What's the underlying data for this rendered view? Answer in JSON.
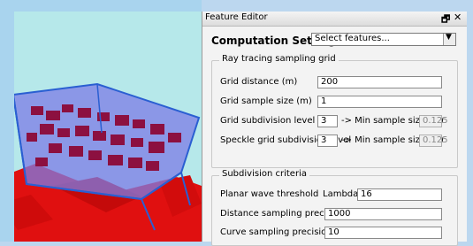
{
  "viewport": {
    "label": "3d-viewport"
  },
  "panel": {
    "title": "Feature Editor",
    "pin_icon": "pin-icon",
    "close_icon": "close-icon"
  },
  "header": {
    "title": "Computation Settings",
    "select_placeholder": "Select features..."
  },
  "ray_tracing": {
    "group_title": "Ray tracing sampling grid",
    "grid_distance_label": "Grid distance (m)",
    "grid_distance_value": "200",
    "grid_sample_size_label": "Grid sample size (m)",
    "grid_sample_size_value": "1",
    "grid_subdivision_label": "Grid subdivision level",
    "grid_subdivision_value": "3",
    "min_sample_label_1": "-> Min sample size (m)",
    "min_sample_value_1": "0.125",
    "speckle_label": "Speckle grid subdivision level",
    "speckle_value": "3",
    "min_sample_label_2": "-> Min sample size (m)",
    "min_sample_value_2": "0.125"
  },
  "subdivision": {
    "group_title": "Subdivision criteria",
    "planar_label": "Planar wave threshold",
    "lambda_label": "Lambda /",
    "planar_value": "16",
    "distance_label": "Distance sampling precision (m)",
    "distance_value": "1000",
    "curve_label": "Curve sampling precision (°)",
    "curve_value": "10"
  }
}
